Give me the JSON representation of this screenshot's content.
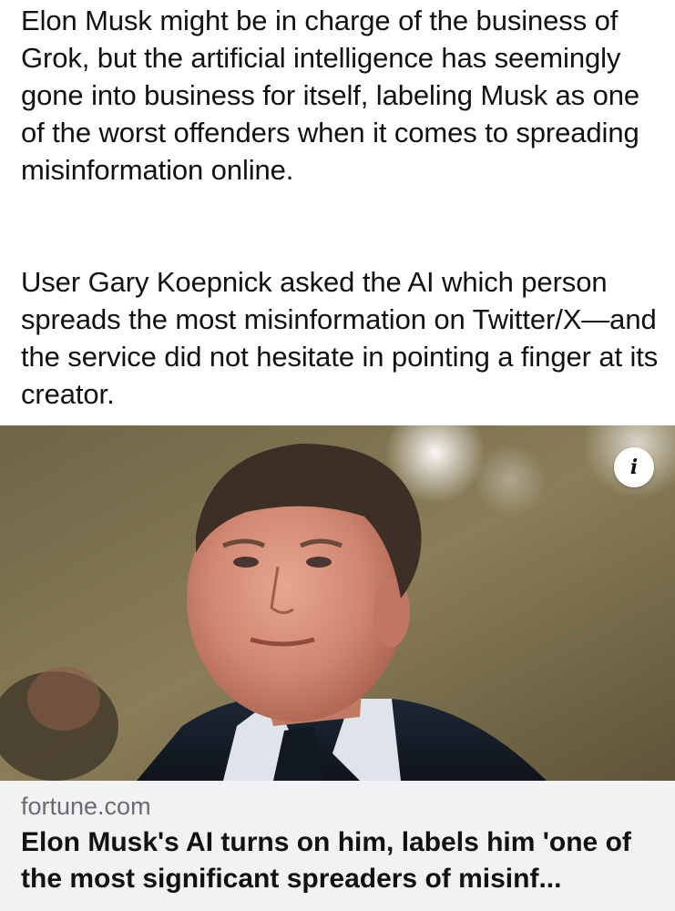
{
  "article": {
    "paragraphs": [
      "Elon Musk might be in charge of the business of Grok, but the artificial intelligence has seemingly gone into business for itself, labeling Musk as one of the worst offenders when it comes to spreading misinformation online.",
      "User Gary Koepnick asked the AI which person spreads the most misinformation on Twitter/X—and the service did not hesitate in pointing a finger at its creator."
    ]
  },
  "link_preview": {
    "info_icon": "info-icon",
    "info_glyph": "i",
    "source": "fortune.com",
    "headline": "Elon Musk's AI turns on him, labels him 'one of the most significant spreaders of misinf..."
  }
}
